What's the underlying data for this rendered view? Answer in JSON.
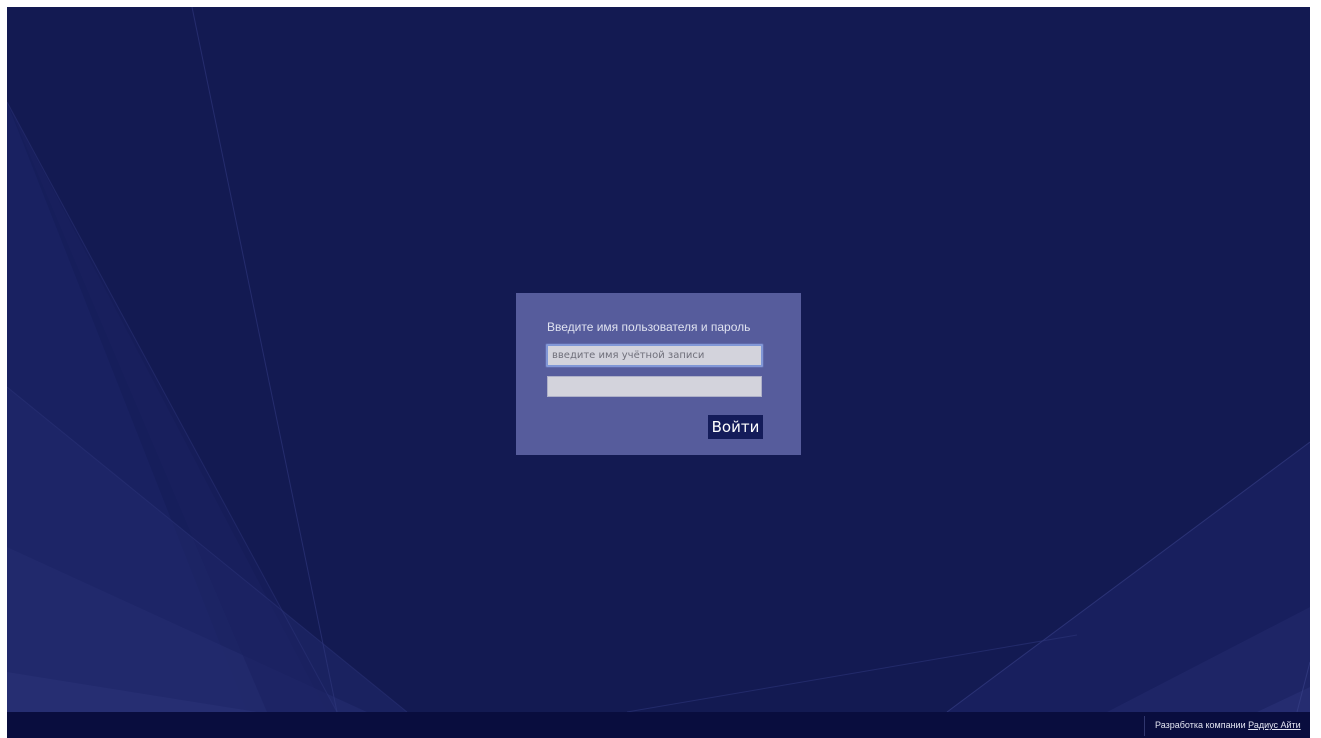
{
  "login": {
    "title": "Введите имя пользователя и пароль",
    "username_placeholder": "введите имя учётной записи",
    "username_value": "",
    "password_value": "",
    "submit_label": "Войти"
  },
  "footer": {
    "credit_prefix": "Разработка компании",
    "company_link": "Радиус Айти"
  },
  "colors": {
    "background": "#131a52",
    "dialog": "#565c9c",
    "button": "#141c5a",
    "footer": "#090d3e"
  }
}
